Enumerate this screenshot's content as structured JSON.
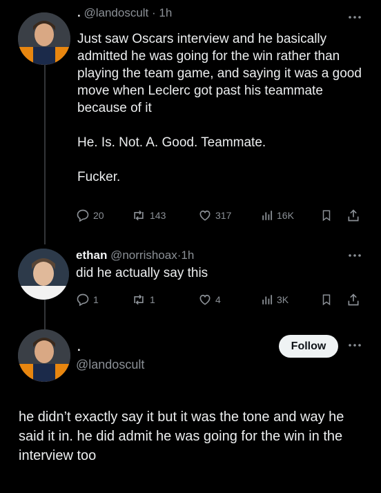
{
  "tweet1": {
    "display_name": ".",
    "handle": "@landoscult",
    "separator": "·",
    "time": "1h",
    "paragraphs": [
      "Just saw Oscars interview and he basically admitted he was going for the win rather than playing the team game, and saying it was a good move when Leclerc got past his teammate because of it",
      "He. Is. Not. A. Good. Teammate.",
      "Fucker."
    ],
    "stats": {
      "replies": "20",
      "reposts": "143",
      "likes": "317",
      "views": "16K"
    }
  },
  "tweet2": {
    "display_name": "ethan",
    "handle": "@norrishoax",
    "separator": "·",
    "time": "1h",
    "text": "did he actually say this",
    "stats": {
      "replies": "1",
      "reposts": "1",
      "likes": "4",
      "views": "3K"
    }
  },
  "focused": {
    "display_name": ".",
    "handle": "@landoscult",
    "follow_label": "Follow",
    "text": "he didn’t exactly say it but it was the tone and way he said it in. he did admit he was going for the win in the interview too"
  },
  "icons": {
    "reply": "speech-bubble-icon",
    "repost": "repost-arrows-icon",
    "like": "heart-icon",
    "views": "bar-chart-icon",
    "bookmark": "bookmark-icon",
    "share": "share-upload-icon",
    "more": "ellipsis-icon"
  },
  "colors": {
    "background": "#000000",
    "text": "#e7e9ea",
    "secondary_text": "#8b9096",
    "thread_line": "#333639",
    "follow_button_bg": "#eff3f4",
    "follow_button_text": "#0f1419"
  }
}
